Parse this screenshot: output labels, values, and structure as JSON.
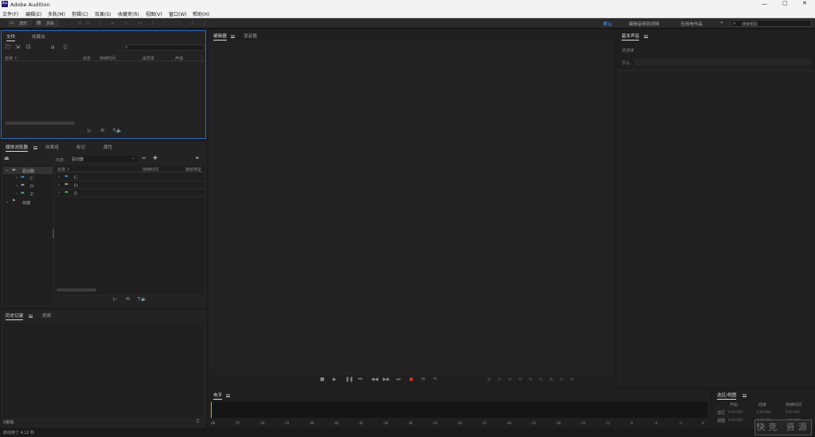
{
  "app": {
    "title": "Adobe Audition",
    "logo": "Au"
  },
  "menu": [
    "文件(F)",
    "编辑(E)",
    "多轨(M)",
    "剪辑(C)",
    "效果(S)",
    "收藏夹(R)",
    "视图(V)",
    "窗口(W)",
    "帮助(H)"
  ],
  "toolbar": {
    "waveform": "波形",
    "multitrack": "多轨",
    "workspace_default": "默认",
    "workspace_edit": "编辑音频到视频",
    "workspace_none": "无线电作品",
    "search_placeholder": "搜索帮助"
  },
  "files_panel": {
    "tabs": [
      "文件",
      "收藏夹"
    ],
    "columns": [
      "名称 ↑",
      "状态",
      "持续时间",
      "采样率",
      "声道"
    ]
  },
  "media_panel": {
    "tabs": [
      "媒体浏览器",
      "效果组",
      "标记",
      "属性"
    ],
    "content_label": "内容:",
    "content_value": "驱动器",
    "tree": [
      "驱动器",
      "C:",
      "D:",
      "Z:",
      "快捷"
    ],
    "columns": [
      "名称 ↑",
      "持续时间",
      "媒体类型"
    ],
    "list": [
      "C:",
      "D:",
      "Z:"
    ]
  },
  "history_panel": {
    "tabs": [
      "历史记录",
      "视频"
    ],
    "undo_count": "0撤销"
  },
  "status": {
    "text": "启动用了 4.12 秒"
  },
  "editor": {
    "tabs": [
      "编辑器",
      "混音器"
    ]
  },
  "essential": {
    "tab": "基本声音",
    "no_selection": "无选择",
    "preset_label": "预设:"
  },
  "level": {
    "tab": "电平",
    "ticks": [
      "dB",
      "-57",
      "-54",
      "-51",
      "-48",
      "-45",
      "-42",
      "-39",
      "-36",
      "-33",
      "-30",
      "-27",
      "-24",
      "-21",
      "-18",
      "-15",
      "-12",
      "-9",
      "-6",
      "-3",
      "0"
    ]
  },
  "selection": {
    "tab": "选区/视图",
    "cols": [
      "开始",
      "结束",
      "持续时间"
    ],
    "rows": [
      "选区",
      "视图"
    ],
    "values": [
      "0:00.000",
      "0:00.000",
      "0:00.000"
    ]
  },
  "watermark": "快克 資源"
}
